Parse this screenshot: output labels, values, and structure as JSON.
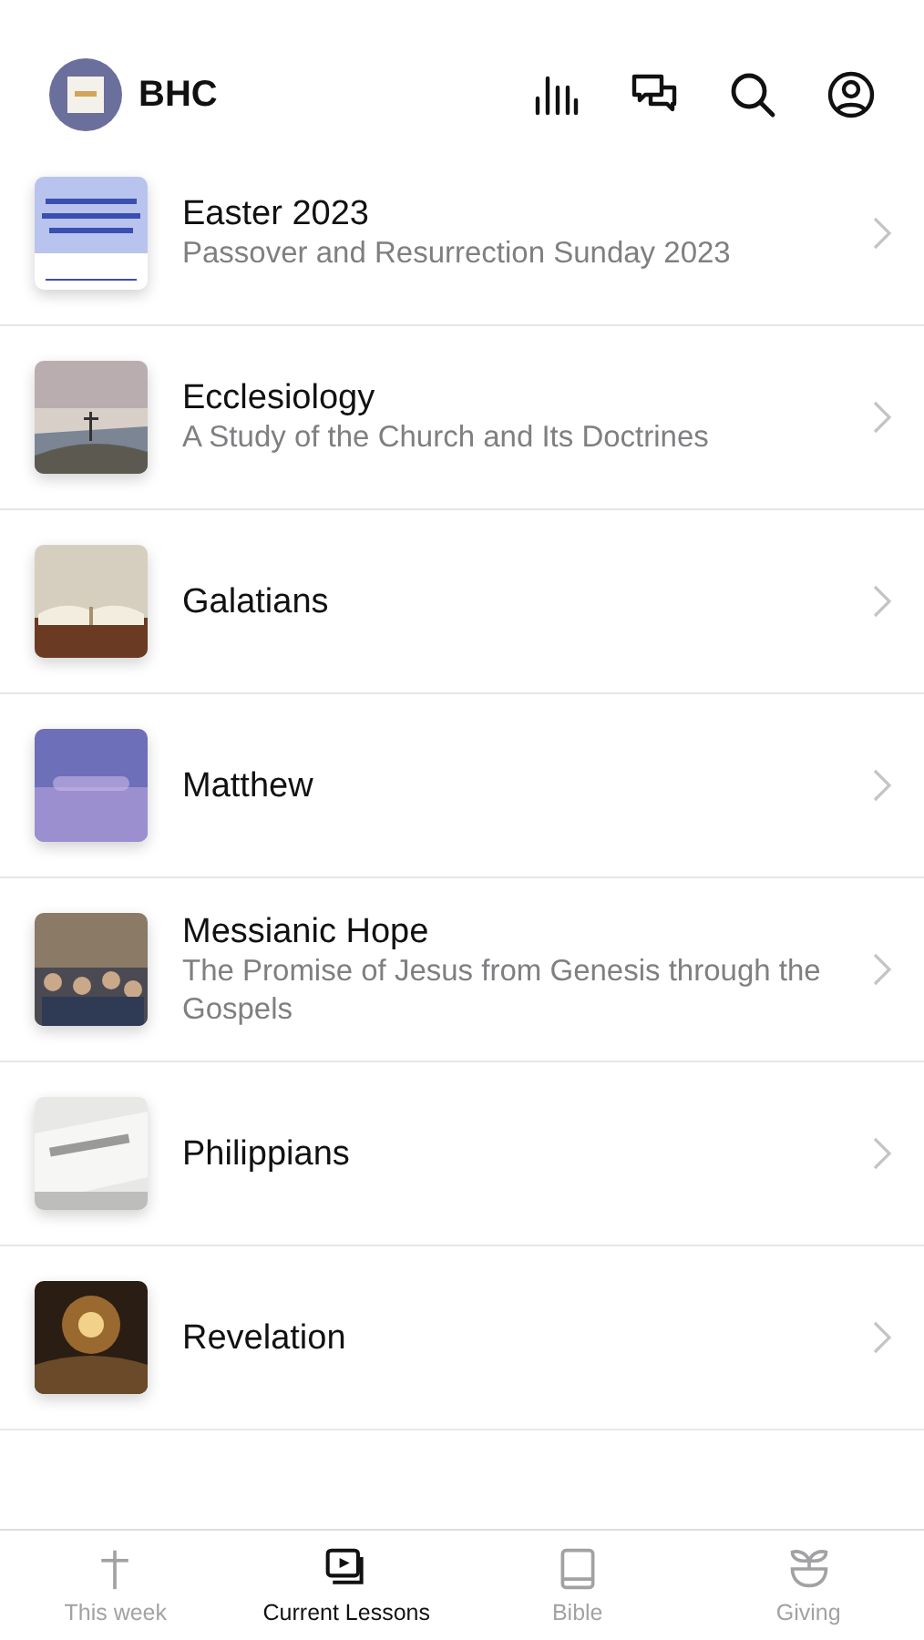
{
  "header": {
    "title": "BHC"
  },
  "lessons": [
    {
      "title": "Easter 2023",
      "subtitle": "Passover and Resurrection Sunday 2023"
    },
    {
      "title": "Ecclesiology",
      "subtitle": "A Study of the Church and Its Doctrines"
    },
    {
      "title": "Galatians"
    },
    {
      "title": "Matthew"
    },
    {
      "title": "Messianic Hope",
      "subtitle": "The Promise of Jesus from Genesis through the Gospels"
    },
    {
      "title": "Philippians"
    },
    {
      "title": "Revelation"
    }
  ],
  "tab_bar": [
    {
      "label": "This week",
      "selected": false
    },
    {
      "label": "Current Lessons",
      "selected": true
    },
    {
      "label": "Bible",
      "selected": false
    },
    {
      "label": "Giving",
      "selected": false
    }
  ]
}
